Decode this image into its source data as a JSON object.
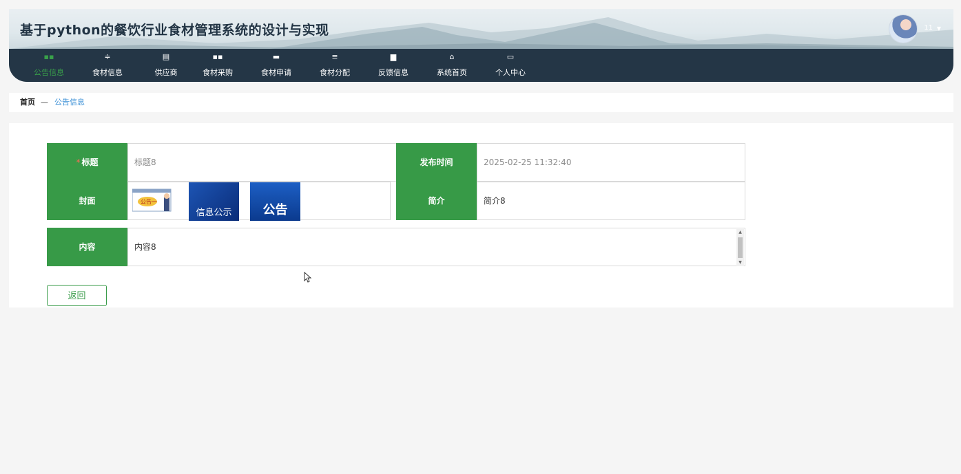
{
  "app": {
    "title": "基于python的餐饮行业食材管理系统的设计与实现",
    "user": {
      "name": "11",
      "caret": "▼"
    }
  },
  "nav": {
    "items": [
      {
        "label": "公告信息",
        "icon": "grid-icon",
        "glyph": "▪▪",
        "active": true
      },
      {
        "label": "食材信息",
        "icon": "sliders-icon",
        "glyph": "≑",
        "active": false
      },
      {
        "label": "供应商",
        "icon": "clipboard-icon",
        "glyph": "▤",
        "active": false
      },
      {
        "label": "食材采购",
        "icon": "grid-icon",
        "glyph": "▪▪",
        "active": false
      },
      {
        "label": "食材申请",
        "icon": "message-icon",
        "glyph": "▬",
        "active": false
      },
      {
        "label": "食材分配",
        "icon": "menu-icon",
        "glyph": "≡",
        "active": false
      },
      {
        "label": "反馈信息",
        "icon": "monitor-icon",
        "glyph": "▆",
        "active": false
      },
      {
        "label": "系统首页",
        "icon": "home-icon",
        "glyph": "⌂",
        "active": false
      },
      {
        "label": "个人中心",
        "icon": "card-icon",
        "glyph": "▭",
        "active": false
      }
    ]
  },
  "breadcrumb": {
    "home": "首页",
    "separator": "—",
    "current": "公告信息"
  },
  "form": {
    "title_label": "标题",
    "title_required_mark": "*",
    "title_value": "标题8",
    "publish_time_label": "发布时间",
    "publish_time_value": "2025-02-25 11:32:40",
    "cover_label": "封面",
    "cover_images": [
      {
        "name": "cover-image-1",
        "text": "公告一"
      },
      {
        "name": "cover-image-2",
        "text": "信息公示"
      },
      {
        "name": "cover-image-3",
        "text": "公告"
      }
    ],
    "intro_label": "简介",
    "intro_value": "简介8",
    "content_label": "内容",
    "content_value": "内容8"
  },
  "buttons": {
    "back": "返回"
  },
  "colors": {
    "accent_green": "#379a47",
    "nav_bg": "#243646",
    "link_blue": "#3a8fd6"
  }
}
